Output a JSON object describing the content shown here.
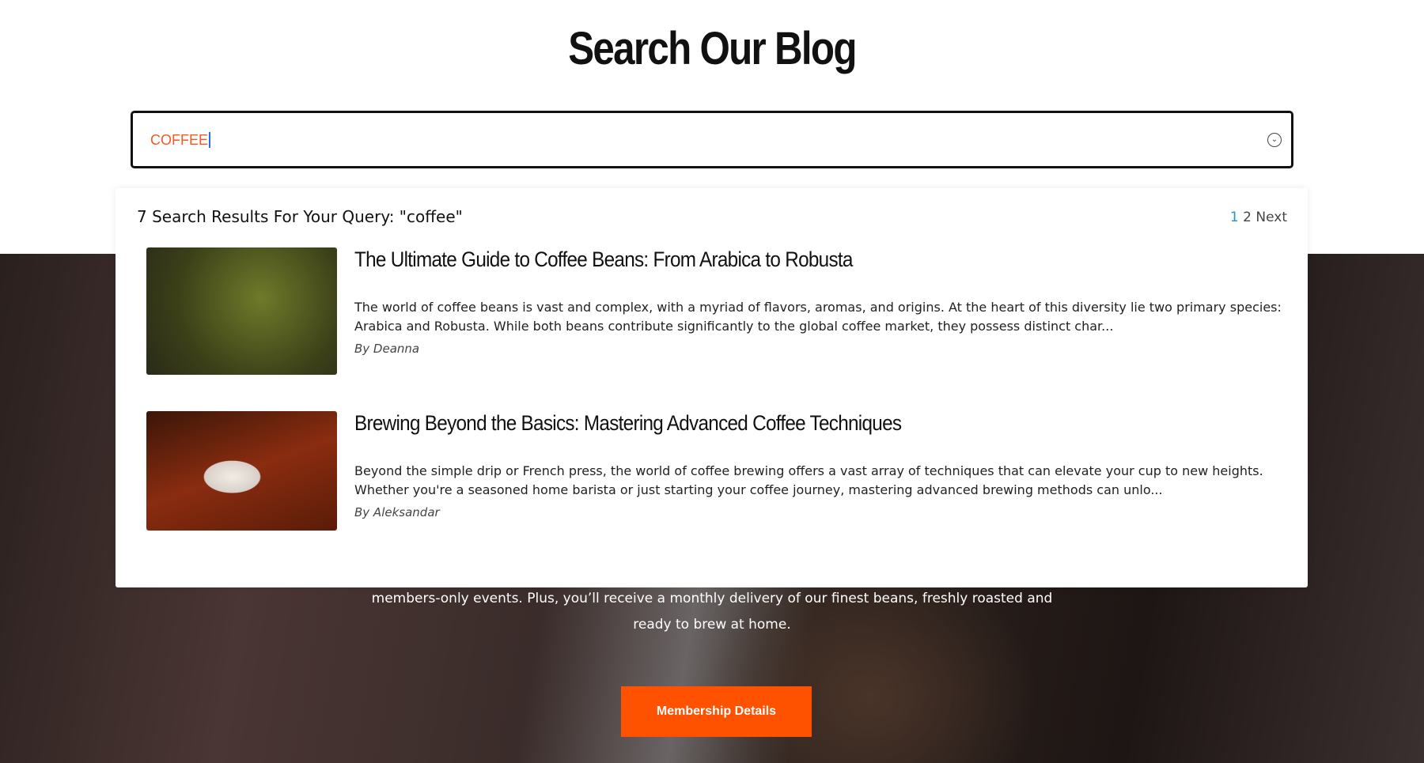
{
  "page": {
    "title": "Search Our Blog"
  },
  "search": {
    "value": "COFFEE",
    "icon": "chevron-down-circle-icon"
  },
  "results": {
    "header": "7 Search Results For Your Query: \"coffee\"",
    "pagination": {
      "current": "1",
      "page2": "2",
      "next": "Next"
    },
    "items": [
      {
        "title": "The Ultimate Guide to Coffee Beans: From Arabica to Robusta",
        "excerpt": "The world of coffee beans is vast and complex, with a myriad of flavors, aromas, and origins. At the heart of this diversity lie two primary species: Arabica and Robusta. While both beans contribute significantly to the global coffee market, they possess distinct char...",
        "author": "By Deanna"
      },
      {
        "title": "Brewing Beyond the Basics: Mastering Advanced Coffee Techniques",
        "excerpt": "Beyond the simple drip or French press, the world of coffee brewing offers a vast array of techniques that can elevate your cup to new heights. Whether you're a seasoned home barista or just starting your coffee journey, mastering advanced brewing methods can unlo...",
        "author": "By Aleksandar"
      }
    ]
  },
  "membership": {
    "line1": "members-only events. Plus, you’ll receive a monthly delivery of our finest beans, freshly roasted and",
    "line2": "ready to brew at home.",
    "button": "Membership Details"
  },
  "colors": {
    "accent": "#ff5200",
    "search_text": "#f05a24",
    "page_link": "#2a8fd6"
  }
}
